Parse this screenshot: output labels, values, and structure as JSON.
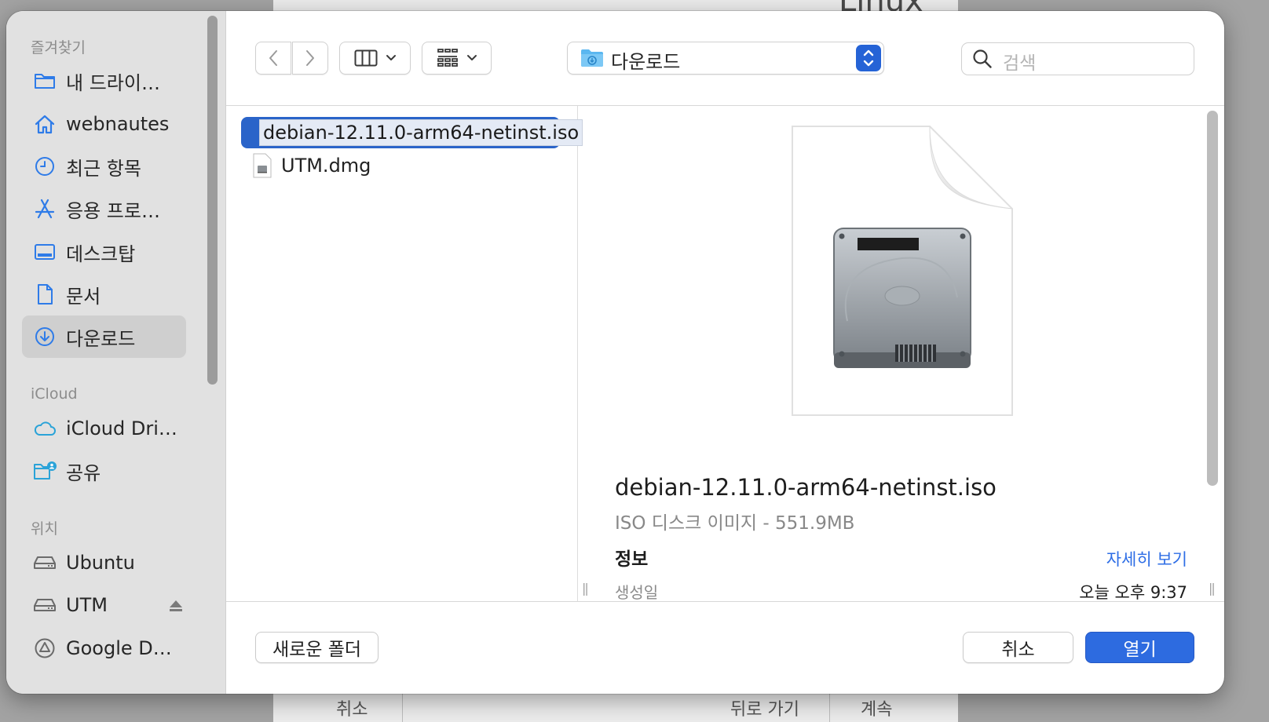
{
  "background_window": {
    "title": "Linux",
    "footer_items": [
      "취소",
      "뒤로 가기",
      "계속"
    ]
  },
  "sidebar": {
    "sections": [
      {
        "label": "즐겨찾기",
        "items": [
          {
            "label": "내 드라이…",
            "icon": "folder-icon"
          },
          {
            "label": "webnautes",
            "icon": "home-icon"
          },
          {
            "label": "최근 항목",
            "icon": "clock-icon"
          },
          {
            "label": "응용 프로…",
            "icon": "applications-icon"
          },
          {
            "label": "데스크탑",
            "icon": "desktop-icon"
          },
          {
            "label": "문서",
            "icon": "document-icon"
          },
          {
            "label": "다운로드",
            "icon": "download-icon",
            "active": true
          }
        ]
      },
      {
        "label": "iCloud",
        "items": [
          {
            "label": "iCloud Dri…",
            "icon": "cloud-icon"
          },
          {
            "label": "공유",
            "icon": "shared-folder-icon"
          }
        ]
      },
      {
        "label": "위치",
        "items": [
          {
            "label": "Ubuntu",
            "icon": "drive-icon"
          },
          {
            "label": "UTM",
            "icon": "drive-icon",
            "eject": true
          },
          {
            "label": "Google D…",
            "icon": "google-drive-icon"
          }
        ]
      }
    ]
  },
  "toolbar": {
    "path_label": "다운로드",
    "search_placeholder": "검색"
  },
  "files": [
    {
      "name": "debian-12.11.0-arm64-netinst.iso",
      "selected": true
    },
    {
      "name": "UTM.dmg",
      "selected": false
    }
  ],
  "preview": {
    "file_name": "debian-12.11.0-arm64-netinst.iso",
    "kind": "ISO 디스크 이미지 - 551.9MB",
    "info_heading": "정보",
    "more_link": "자세히 보기",
    "created_label": "생성일",
    "created_value": "오늘 오후 9:37"
  },
  "footer": {
    "new_folder": "새로운 폴더",
    "cancel": "취소",
    "open": "열기"
  },
  "colors": {
    "accent": "#2d6be0",
    "selection": "#2a64c9",
    "sidebar_icon": "#2e7be8"
  }
}
